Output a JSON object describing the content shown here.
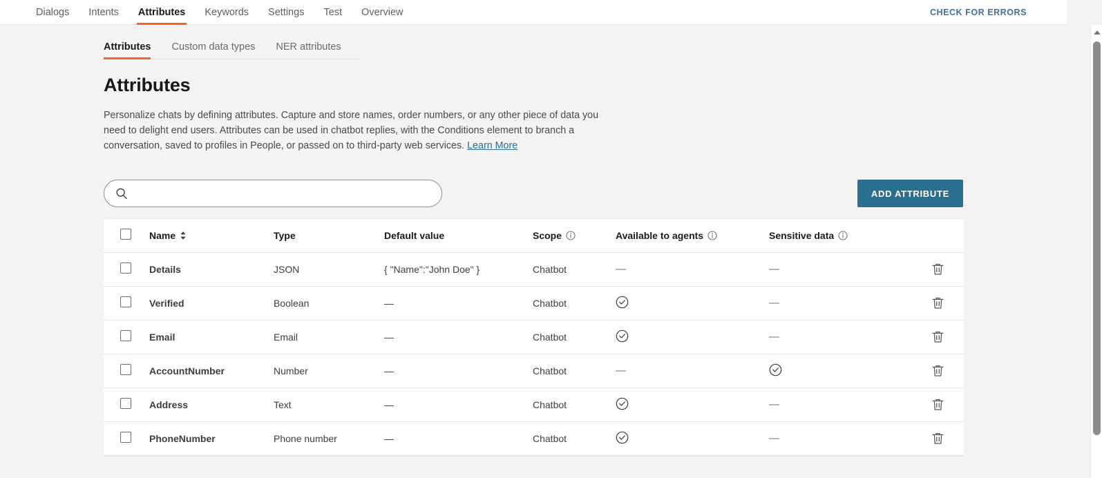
{
  "topnav": {
    "items": [
      {
        "label": "Dialogs",
        "active": false
      },
      {
        "label": "Intents",
        "active": false
      },
      {
        "label": "Attributes",
        "active": true
      },
      {
        "label": "Keywords",
        "active": false
      },
      {
        "label": "Settings",
        "active": false
      },
      {
        "label": "Test",
        "active": false
      },
      {
        "label": "Overview",
        "active": false
      }
    ],
    "check_errors_label": "CHECK FOR ERRORS"
  },
  "subtabs": [
    {
      "label": "Attributes",
      "active": true
    },
    {
      "label": "Custom data types",
      "active": false
    },
    {
      "label": "NER attributes",
      "active": false
    }
  ],
  "page": {
    "title": "Attributes",
    "description": "Personalize chats by defining attributes. Capture and store names, order numbers, or any other piece of data you need to delight end users. Attributes can be used in chatbot replies, with the Conditions element to branch a conversation, saved to profiles in People, or passed on to third-party web services.",
    "learn_more_label": "Learn More"
  },
  "search": {
    "value": "",
    "placeholder": "",
    "icon": "search-icon"
  },
  "add_button": {
    "label": "ADD ATTRIBUTE"
  },
  "table": {
    "headers": [
      {
        "label": "",
        "icon": "checkbox-icon"
      },
      {
        "label": "Name",
        "icon": "sort-icon"
      },
      {
        "label": "Type",
        "icon": ""
      },
      {
        "label": "Default value",
        "icon": ""
      },
      {
        "label": "Scope",
        "icon": "info-icon"
      },
      {
        "label": "Available to agents",
        "icon": "info-icon"
      },
      {
        "label": "Sensitive data",
        "icon": "info-icon"
      },
      {
        "label": "",
        "icon": ""
      }
    ],
    "rows": [
      {
        "selected": false,
        "name": "Details",
        "type": "JSON",
        "default_value": "{ \"Name\":\"John Doe\" }",
        "scope": "Chatbot",
        "available_to_agents": "—",
        "sensitive_data": "—"
      },
      {
        "selected": false,
        "name": "Verified",
        "type": "Boolean",
        "default_value": "—",
        "scope": "Chatbot",
        "available_to_agents": "check",
        "sensitive_data": "—"
      },
      {
        "selected": false,
        "name": "Email",
        "type": "Email",
        "default_value": "—",
        "scope": "Chatbot",
        "available_to_agents": "check",
        "sensitive_data": "—"
      },
      {
        "selected": false,
        "name": "AccountNumber",
        "type": "Number",
        "default_value": "—",
        "scope": "Chatbot",
        "available_to_agents": "—",
        "sensitive_data": "check"
      },
      {
        "selected": false,
        "name": "Address",
        "type": "Text",
        "default_value": "—",
        "scope": "Chatbot",
        "available_to_agents": "check",
        "sensitive_data": "—"
      },
      {
        "selected": false,
        "name": "PhoneNumber",
        "type": "Phone number",
        "default_value": "—",
        "scope": "Chatbot",
        "available_to_agents": "check",
        "sensitive_data": "—"
      }
    ],
    "row_actions": {
      "edit": "edit-pencil-icon",
      "delete": "trash-icon"
    }
  },
  "colors": {
    "accent_orange": "#f26522",
    "button_blue": "#2c6e8f",
    "link_blue": "#2c6e9b",
    "page_bg": "#f4f3f1",
    "card_bg": "#ffffff"
  }
}
